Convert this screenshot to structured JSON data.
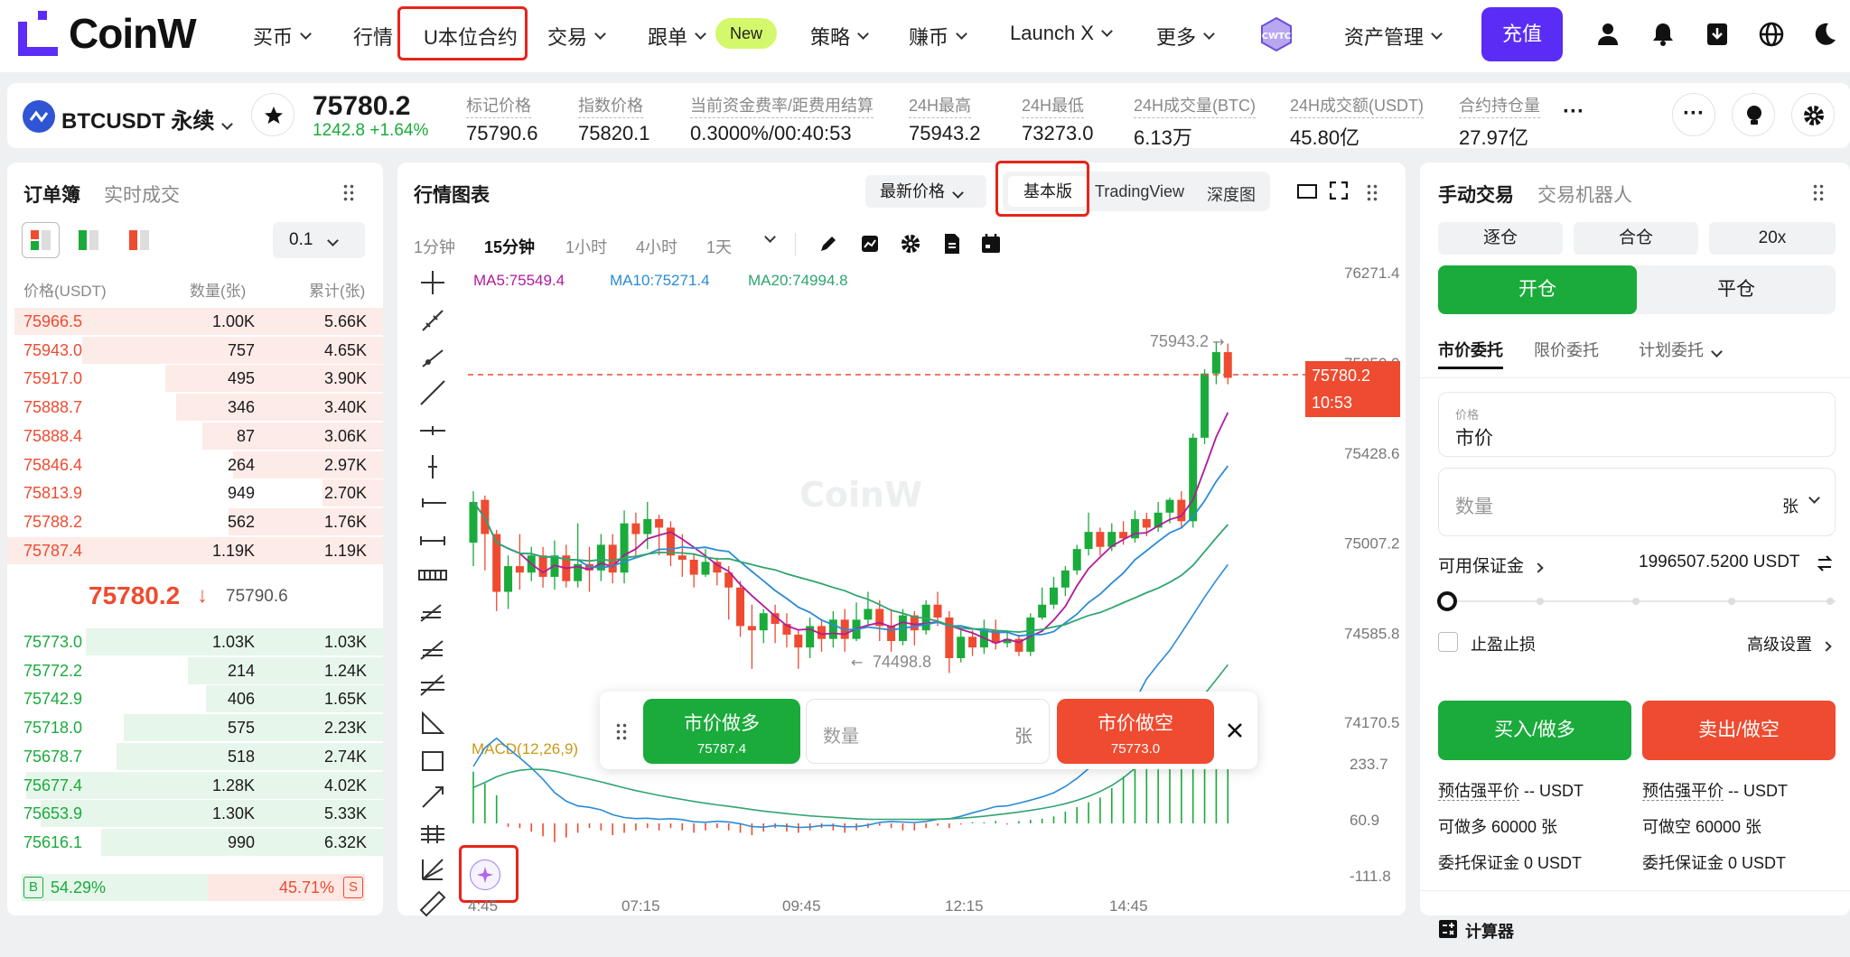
{
  "nav": {
    "logo": "CoinW",
    "items": [
      {
        "label": "买币",
        "dropdown": true
      },
      {
        "label": "行情",
        "dropdown": false
      },
      {
        "label": "U本位合约",
        "dropdown": false,
        "highlight": true
      },
      {
        "label": "交易",
        "dropdown": true
      },
      {
        "label": "跟单",
        "dropdown": true,
        "badge": "New"
      },
      {
        "label": "策略",
        "dropdown": true
      },
      {
        "label": "赚币",
        "dropdown": true
      },
      {
        "label": "Launch X",
        "dropdown": true
      },
      {
        "label": "更多",
        "dropdown": true
      },
      {
        "label": "资产管理",
        "dropdown": true
      }
    ],
    "deposit": "充值",
    "icons": [
      "game-badge-icon",
      "user-icon",
      "bell-icon",
      "download-icon",
      "globe-icon",
      "moon-icon"
    ]
  },
  "ticker": {
    "symbol": "BTCUSDT 永续",
    "price": "75780.2",
    "change": "1242.8 +1.64%",
    "stats": [
      {
        "label": "标记价格",
        "value": "75790.6"
      },
      {
        "label": "指数价格",
        "value": "75820.1"
      },
      {
        "label": "当前资金费率/距费用结算",
        "value": "0.3000%/00:40:53"
      },
      {
        "label": "24H最高",
        "value": "75943.2"
      },
      {
        "label": "24H最低",
        "value": "73273.0"
      },
      {
        "label": "24H成交量(BTC)",
        "value": "6.13万"
      },
      {
        "label": "24H成交额(USDT)",
        "value": "45.80亿"
      },
      {
        "label": "合约持仓量",
        "value": "27.97亿"
      }
    ],
    "more": "···"
  },
  "orderbook": {
    "tabs": [
      "订单簿",
      "实时成交"
    ],
    "precision": "0.1",
    "headers": [
      "价格(USDT)",
      "数量(张)",
      "累计(张)"
    ],
    "asks": [
      {
        "price": "75966.5",
        "qty": "1.00K",
        "total": "5.66K",
        "depth": 0.98
      },
      {
        "price": "75943.0",
        "qty": "757",
        "total": "4.65K",
        "depth": 0.8
      },
      {
        "price": "75917.0",
        "qty": "495",
        "total": "3.90K",
        "depth": 0.58
      },
      {
        "price": "75888.7",
        "qty": "346",
        "total": "3.40K",
        "depth": 0.55
      },
      {
        "price": "75888.4",
        "qty": "87",
        "total": "3.06K",
        "depth": 0.48
      },
      {
        "price": "75846.4",
        "qty": "264",
        "total": "2.97K",
        "depth": 0.4
      },
      {
        "price": "75813.9",
        "qty": "949",
        "total": "2.70K",
        "depth": 0.16
      },
      {
        "price": "75788.2",
        "qty": "562",
        "total": "1.76K",
        "depth": 0.41
      },
      {
        "price": "75787.4",
        "qty": "1.19K",
        "total": "1.19K",
        "depth": 1.0
      }
    ],
    "mid_price": "75780.2",
    "mid_arrow": "↓",
    "mark_price": "75790.6",
    "bids": [
      {
        "price": "75773.0",
        "qty": "1.03K",
        "total": "1.03K",
        "depth": 0.79
      },
      {
        "price": "75772.2",
        "qty": "214",
        "total": "1.24K",
        "depth": 0.52
      },
      {
        "price": "75742.9",
        "qty": "406",
        "total": "1.65K",
        "depth": 0.47
      },
      {
        "price": "75718.0",
        "qty": "575",
        "total": "2.23K",
        "depth": 0.69
      },
      {
        "price": "75678.7",
        "qty": "518",
        "total": "2.74K",
        "depth": 0.71
      },
      {
        "price": "75677.4",
        "qty": "1.28K",
        "total": "4.02K",
        "depth": 0.95
      },
      {
        "price": "75653.9",
        "qty": "1.30K",
        "total": "5.33K",
        "depth": 0.91
      },
      {
        "price": "75616.1",
        "qty": "990",
        "total": "6.32K",
        "depth": 0.75
      }
    ],
    "buy_ratio_label": "B",
    "buy_ratio": "54.29%",
    "sell_ratio": "45.71%",
    "sell_ratio_label": "S",
    "buy_fraction": 0.5429
  },
  "chart": {
    "title": "行情图表",
    "price_type": "最新价格",
    "view_tabs": [
      "基本版",
      "TradingView",
      "深度图"
    ],
    "intervals": [
      "1分钟",
      "15分钟",
      "1小时",
      "4小时",
      "1天"
    ],
    "active_interval": "15分钟",
    "ma": {
      "ma5": "MA5:75549.4",
      "ma10": "MA10:75271.4",
      "ma20": "MA20:74994.8"
    },
    "y_ticks": [
      "76271.4",
      "75850.0",
      "75428.6",
      "75007.2",
      "74585.8",
      "74170.5"
    ],
    "x_ticks": [
      "4:45",
      "07:15",
      "09:45",
      "12:15",
      "14:45"
    ],
    "last_price": "75780.2",
    "countdown": "10:53",
    "high_marker": "75943.2",
    "low_marker": "74498.8",
    "watermark": "CoinW",
    "macd_label": "MACD(12,26,9)",
    "macd_ticks": [
      "233.7",
      "60.9",
      "-111.8"
    ],
    "quick": {
      "buy_label": "市价做多",
      "buy_price": "75787.4",
      "qty_placeholder": "数量",
      "unit": "张",
      "sell_label": "市价做空",
      "sell_price": "75773.0"
    }
  },
  "chart_data": {
    "type": "candlestick",
    "ylim": [
      74170.5,
      76271.4
    ],
    "candles": [
      [
        75010,
        75200,
        75250,
        74900
      ],
      [
        75210,
        75050,
        75230,
        74880
      ],
      [
        75050,
        74780,
        75070,
        74690
      ],
      [
        74780,
        74900,
        74950,
        74700
      ],
      [
        74900,
        74870,
        75050,
        74790
      ],
      [
        74870,
        74950,
        74990,
        74830
      ],
      [
        74950,
        74850,
        74990,
        74800
      ],
      [
        74850,
        74950,
        75020,
        74790
      ],
      [
        74950,
        74830,
        75000,
        74800
      ],
      [
        74830,
        74910,
        75100,
        74800
      ],
      [
        74910,
        74880,
        74990,
        74780
      ],
      [
        74880,
        75000,
        75050,
        74830
      ],
      [
        75000,
        74870,
        75050,
        74820
      ],
      [
        74870,
        75100,
        75160,
        74820
      ],
      [
        75100,
        75050,
        75150,
        74950
      ],
      [
        75050,
        75120,
        75200,
        74980
      ],
      [
        75120,
        75080,
        75140,
        74950
      ],
      [
        75080,
        74950,
        75110,
        74900
      ],
      [
        74950,
        74930,
        75050,
        74850
      ],
      [
        74930,
        74860,
        74960,
        74800
      ],
      [
        74860,
        74920,
        74980,
        74850
      ],
      [
        74920,
        74870,
        74940,
        74810
      ],
      [
        74870,
        74800,
        74900,
        74650
      ],
      [
        74800,
        74620,
        74830,
        74570
      ],
      [
        74620,
        74600,
        74720,
        74420
      ],
      [
        74600,
        74680,
        74700,
        74540
      ],
      [
        74680,
        74630,
        74720,
        74540
      ],
      [
        74630,
        74580,
        74680,
        74520
      ],
      [
        74580,
        74520,
        74600,
        74420
      ],
      [
        74520,
        74620,
        74660,
        74470
      ],
      [
        74620,
        74560,
        74650,
        74500
      ],
      [
        74560,
        74650,
        74690,
        74520
      ],
      [
        74650,
        74560,
        74700,
        74500
      ],
      [
        74560,
        74650,
        74730,
        74550
      ],
      [
        74650,
        74700,
        74780,
        74620
      ],
      [
        74700,
        74620,
        74740,
        74550
      ],
      [
        74620,
        74550,
        74700,
        74500
      ],
      [
        74550,
        74670,
        74700,
        74530
      ],
      [
        74670,
        74600,
        74690,
        74530
      ],
      [
        74600,
        74720,
        74740,
        74580
      ],
      [
        74720,
        74660,
        74780,
        74620
      ],
      [
        74660,
        74470,
        74690,
        74400
      ],
      [
        74470,
        74570,
        74600,
        74450
      ],
      [
        74570,
        74520,
        74600,
        74480
      ],
      [
        74520,
        74600,
        74650,
        74490
      ],
      [
        74600,
        74540,
        74650,
        74510
      ],
      [
        74540,
        74560,
        74600,
        74520
      ],
      [
        74560,
        74500,
        74580,
        74480
      ],
      [
        74500,
        74660,
        74680,
        74480
      ],
      [
        74660,
        74720,
        74800,
        74650
      ],
      [
        74720,
        74800,
        74850,
        74700
      ],
      [
        74800,
        74880,
        74900,
        74760
      ],
      [
        74880,
        74980,
        75000,
        74860
      ],
      [
        74980,
        75060,
        75150,
        74950
      ],
      [
        75060,
        74990,
        75080,
        74950
      ],
      [
        74990,
        75060,
        75100,
        74970
      ],
      [
        75060,
        75030,
        75110,
        75000
      ],
      [
        75030,
        75120,
        75160,
        75010
      ],
      [
        75120,
        75080,
        75150,
        75040
      ],
      [
        75080,
        75150,
        75200,
        75060
      ],
      [
        75150,
        75210,
        75220,
        75100
      ],
      [
        75210,
        75110,
        75250,
        75080
      ],
      [
        75110,
        75500,
        75520,
        75080
      ],
      [
        75500,
        75800,
        75820,
        75470
      ],
      [
        75800,
        75900,
        75950,
        75750
      ],
      [
        75900,
        75780,
        75940,
        75750
      ]
    ],
    "macd_hist": [
      220,
      170,
      120,
      -15,
      -20,
      -35,
      -55,
      -80,
      -60,
      -40,
      -20,
      -30,
      -50,
      -40,
      -30,
      -20,
      -30,
      -20,
      -30,
      -40,
      -30,
      -20,
      -30,
      -40,
      -50,
      -35,
      -20,
      -35,
      -40,
      -30,
      -20,
      -30,
      -40,
      -30,
      -20,
      -10,
      -20,
      -30,
      -30,
      -20,
      -10,
      -20,
      -5,
      5,
      5,
      10,
      -5,
      10,
      15,
      20,
      30,
      50,
      70,
      90,
      110,
      150,
      200,
      240,
      260,
      230,
      240,
      280,
      300,
      320,
      330,
      340
    ]
  },
  "trade": {
    "tabs": [
      "手动交易",
      "交易机器人"
    ],
    "margin_modes": [
      "逐仓",
      "合仓",
      "20x"
    ],
    "open": "开仓",
    "close": "平仓",
    "order_types": [
      "市价委托",
      "限价委托",
      "计划委托"
    ],
    "price_label": "价格",
    "price_value": "市价",
    "qty_placeholder": "数量",
    "unit": "张",
    "avail_label": "可用保证金",
    "avail_value": "1996507.5200 USDT",
    "tpsl": "止盈止损",
    "advanced": "高级设置",
    "buy_btn": "买入/做多",
    "sell_btn": "卖出/做空",
    "est_liq_label": "预估强平价",
    "est_liq_long": "-- USDT",
    "est_liq_short": "-- USDT",
    "max_long": "可做多 60000 张",
    "max_short": "可做空 60000 张",
    "margin_long": "委托保证金 0 USDT",
    "margin_short": "委托保证金 0 USDT",
    "calculator": "计算器"
  },
  "colors": {
    "up": "#1aab3b",
    "down": "#ee4b31",
    "accent": "#5b2cf5"
  }
}
